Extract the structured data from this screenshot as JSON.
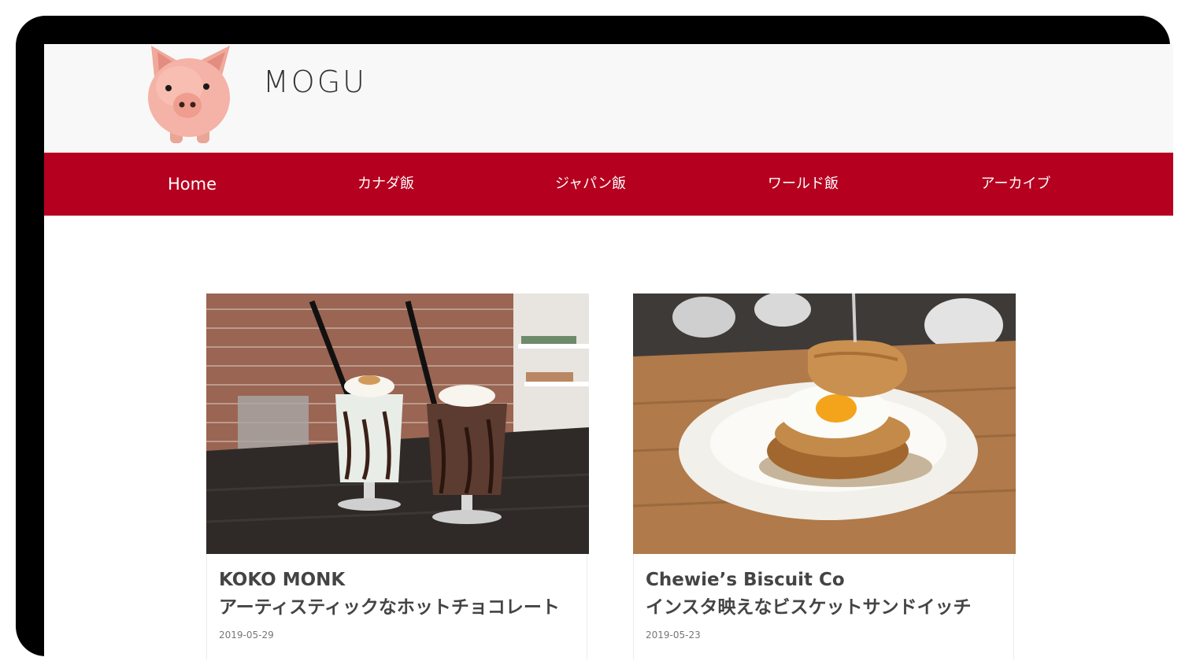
{
  "site": {
    "title": "MOGU",
    "logo_icon": "pig-piggy-bank-icon",
    "brand_color": "#b5001f"
  },
  "nav": {
    "items": [
      {
        "label": "Home"
      },
      {
        "label": "カナダ飯"
      },
      {
        "label": "ジャパン飯"
      },
      {
        "label": "ワールド飯"
      },
      {
        "label": "アーカイブ"
      }
    ]
  },
  "posts": [
    {
      "title_line1": "KOKO MONK",
      "title_line2": "アーティスティックなホットチョコレート",
      "date": "2019-05-29",
      "image": "two-chocolate-drinks-photo"
    },
    {
      "title_line1": "Chewie’s Biscuit Co",
      "title_line2": "インスタ映えなビスケットサンドイッチ",
      "date": "2019-05-23",
      "image": "biscuit-sandwich-egg-photo"
    }
  ]
}
